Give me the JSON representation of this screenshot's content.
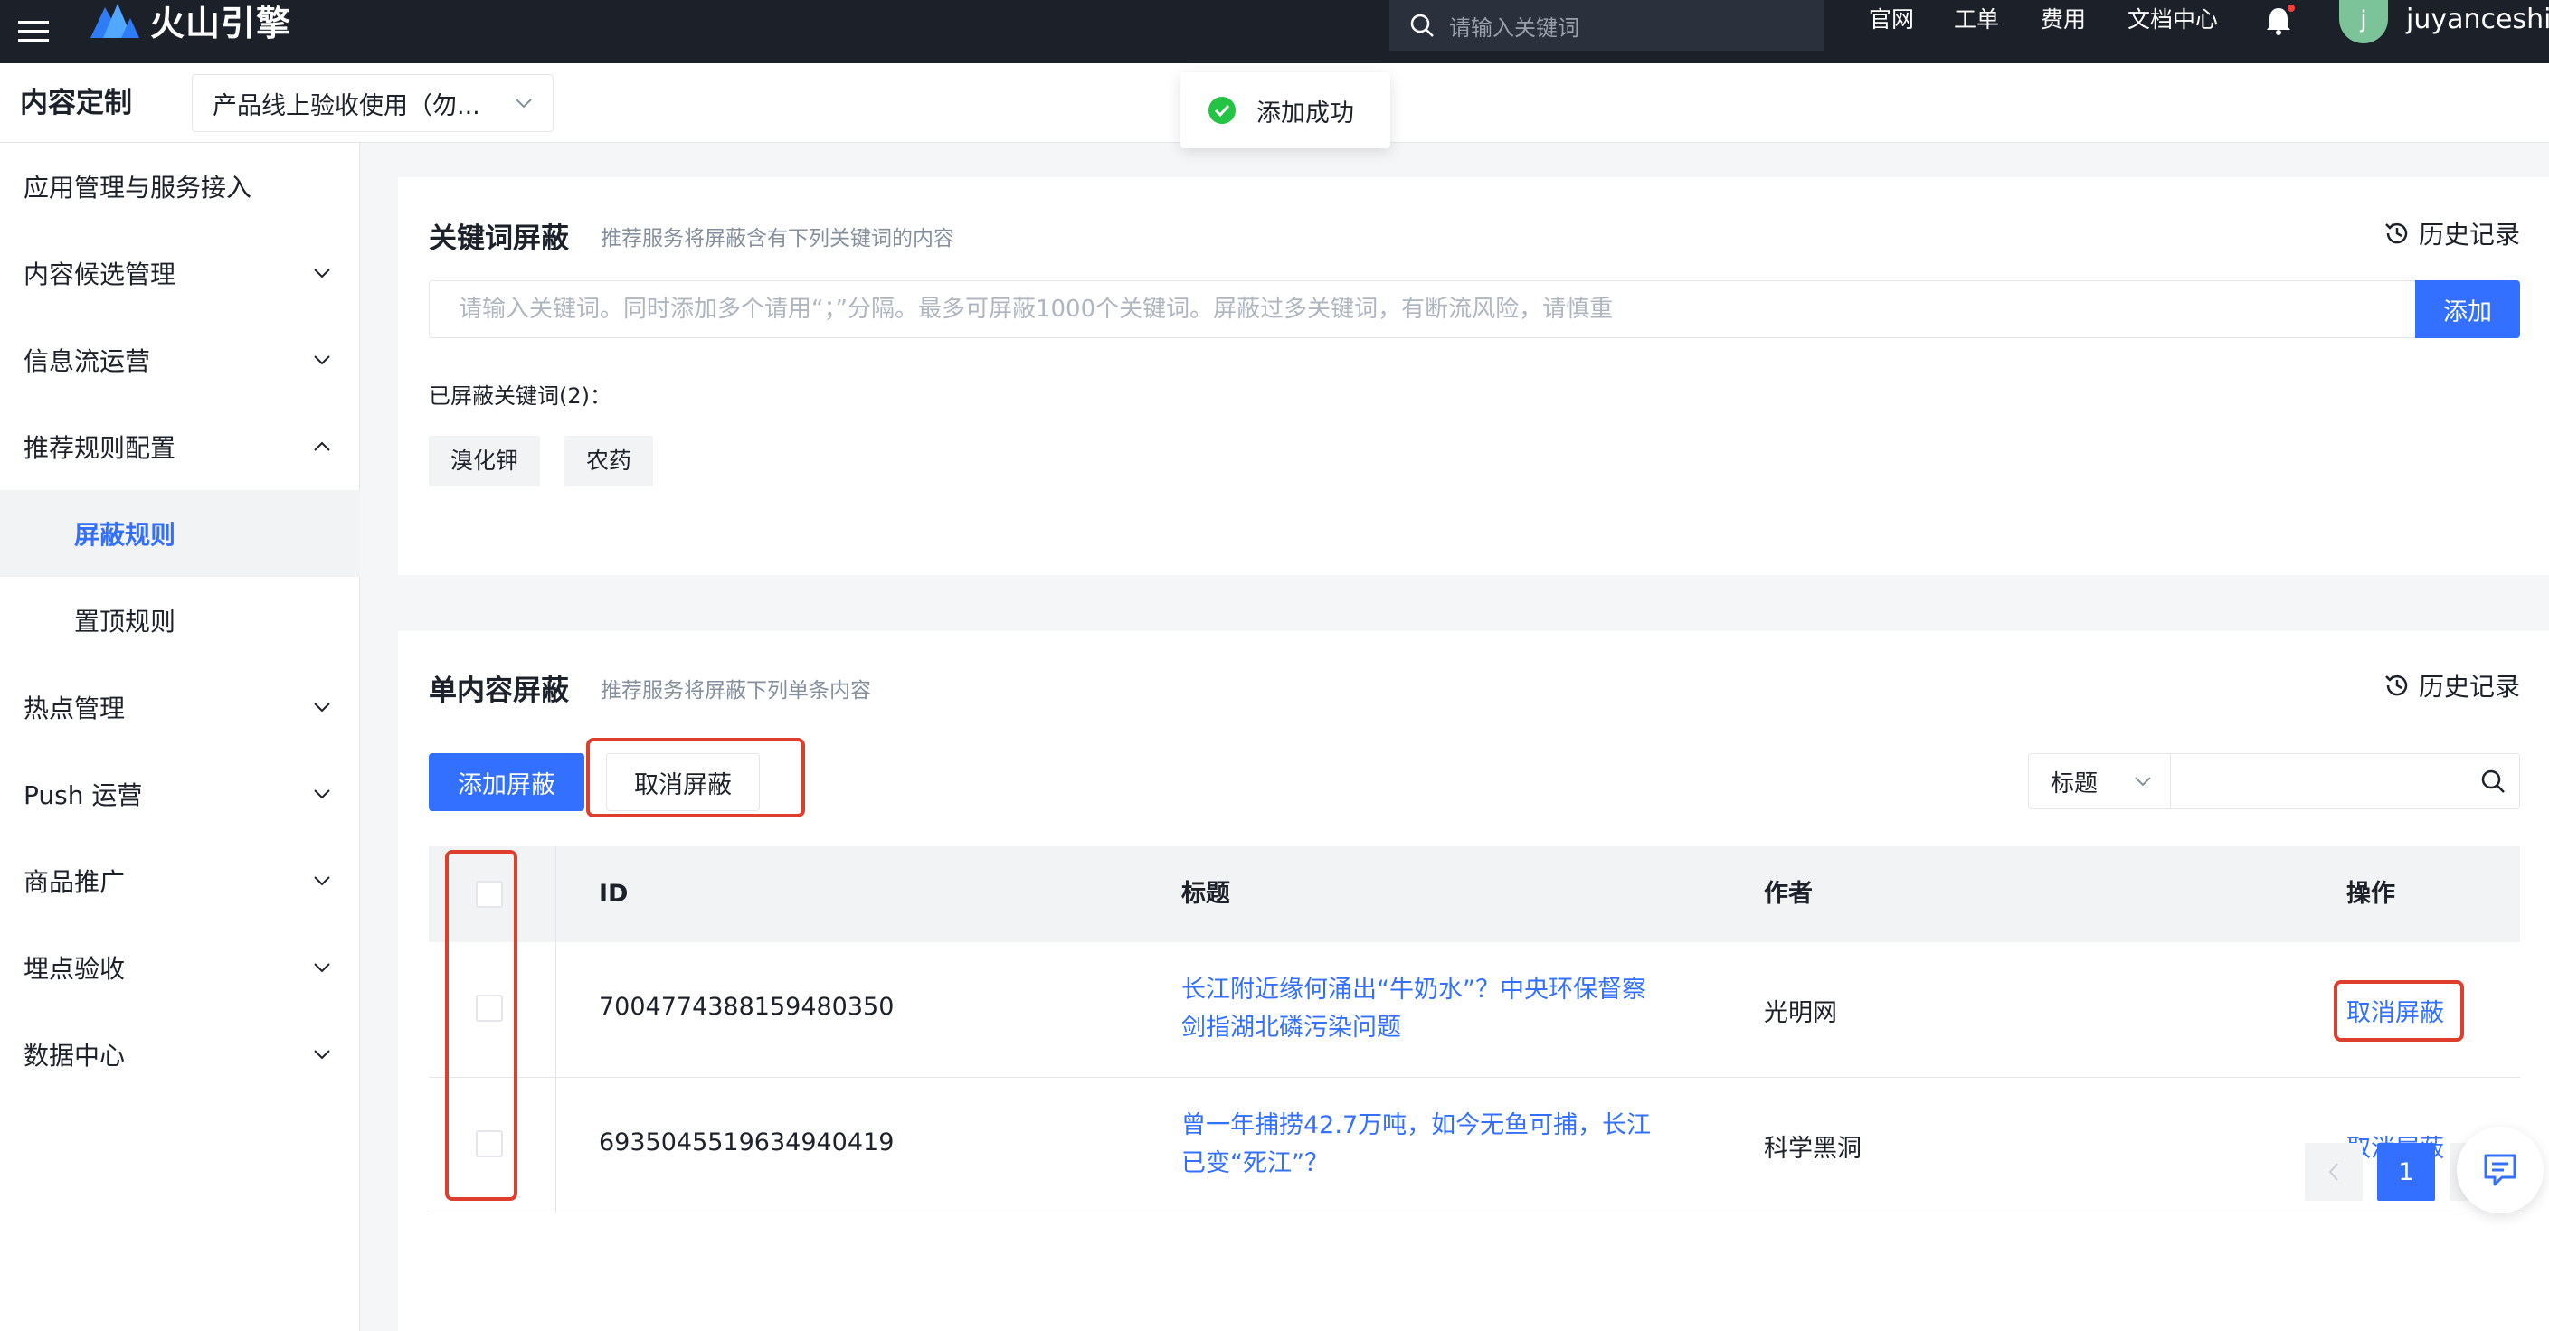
{
  "topbar": {
    "logo_text": "火山引擎",
    "search_placeholder": "请输入关键词",
    "links": [
      "官网",
      "工单",
      "费用",
      "文档中心"
    ],
    "avatar_initial": "j",
    "username": "juyanceshi"
  },
  "subheader": {
    "title": "内容定制",
    "product_select": "产品线上验收使用（勿..."
  },
  "toast": {
    "text": "添加成功"
  },
  "sidebar": {
    "items": [
      {
        "label": "应用管理与服务接入",
        "chevron": "none"
      },
      {
        "label": "内容候选管理",
        "chevron": "down"
      },
      {
        "label": "信息流运营",
        "chevron": "down"
      },
      {
        "label": "推荐规则配置",
        "chevron": "up"
      },
      {
        "label": "屏蔽规则",
        "chevron": "none",
        "active": true
      },
      {
        "label": "置顶规则",
        "chevron": "none"
      },
      {
        "label": "热点管理",
        "chevron": "down"
      },
      {
        "label": "Push 运营",
        "chevron": "down"
      },
      {
        "label": "商品推广",
        "chevron": "down"
      },
      {
        "label": "埋点验收",
        "chevron": "down"
      },
      {
        "label": "数据中心",
        "chevron": "down"
      }
    ]
  },
  "keyword_card": {
    "title": "关键词屏蔽",
    "desc": "推荐服务将屏蔽含有下列关键词的内容",
    "history": "历史记录",
    "input_placeholder": "请输入关键词。同时添加多个请用“；”分隔。最多可屏蔽1000个关键词。屏蔽过多关键词，有断流风险，请慎重",
    "add_button": "添加",
    "blocked_label": "已屏蔽关键词(2)：",
    "tags": [
      "溴化钾",
      "农药"
    ]
  },
  "content_card": {
    "title": "单内容屏蔽",
    "desc": "推荐服务将屏蔽下列单条内容",
    "history": "历史记录",
    "add_button": "添加屏蔽",
    "cancel_button": "取消屏蔽",
    "filter_select": "标题",
    "columns": {
      "id": "ID",
      "title": "标题",
      "author": "作者",
      "action": "操作"
    },
    "rows": [
      {
        "id": "7004774388159480350",
        "title_line1": "长江附近缘何涌出“牛奶水”？中央环保督察",
        "title_line2": "剑指湖北磷污染问题",
        "author": "光明网",
        "action": "取消屏蔽"
      },
      {
        "id": "6935045519634940419",
        "title_line1": "曾一年捕捞42.7万吨，如今无鱼可捕，长江",
        "title_line2": "已变“死江”？",
        "author": "科学黑洞",
        "action": "取消屏蔽"
      }
    ],
    "pagination": {
      "current_page": "1"
    }
  },
  "colors": {
    "primary": "#3370ff",
    "highlight": "#e03e2d",
    "topbar": "#1c2029",
    "success": "#23c343"
  }
}
